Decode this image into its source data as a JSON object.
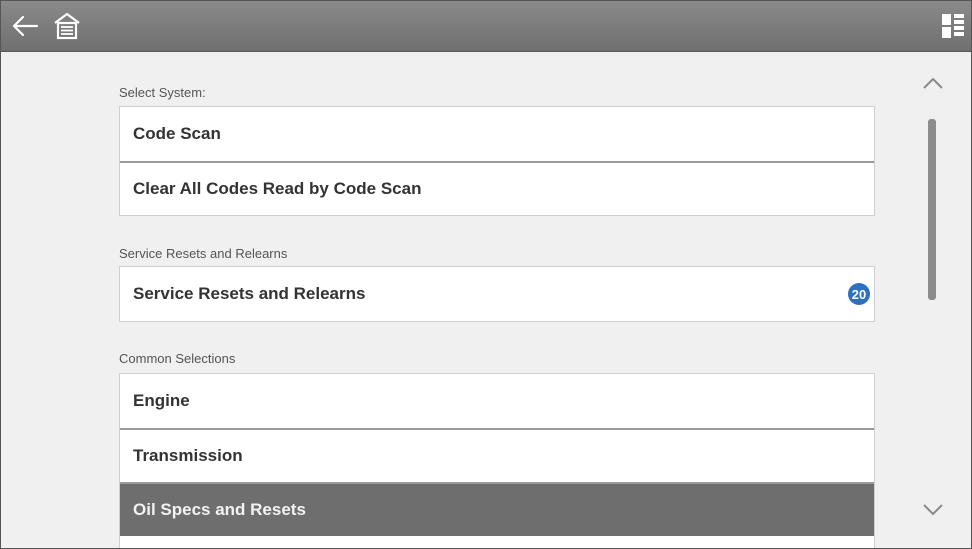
{
  "header": {
    "back_icon": "back-arrow-icon",
    "home_icon": "home-icon",
    "menu_icon": "grid-menu-icon"
  },
  "sections": [
    {
      "label": "Select System:",
      "items": [
        {
          "label": "Code Scan"
        },
        {
          "label": "Clear All Codes Read by Code Scan"
        }
      ]
    },
    {
      "label": "Service Resets and Relearns",
      "items": [
        {
          "label": "Service Resets and Relearns",
          "badge": "20"
        }
      ]
    },
    {
      "label": "Common Selections",
      "items": [
        {
          "label": "Engine"
        },
        {
          "label": "Transmission"
        },
        {
          "label": "Oil Specs and Resets",
          "selected": true
        }
      ]
    }
  ],
  "colors": {
    "badge": "#2e6fbf",
    "selected_row": "#6e6e6e",
    "topbar": "#7a7a7a"
  }
}
